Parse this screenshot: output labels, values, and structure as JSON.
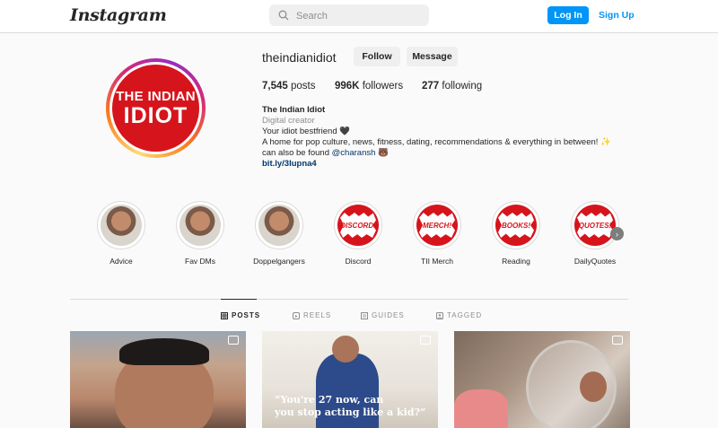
{
  "header": {
    "logo": "Instagram",
    "search_placeholder": "Search",
    "login_label": "Log In",
    "signup_label": "Sign Up"
  },
  "profile": {
    "username": "theindianidiot",
    "follow_label": "Follow",
    "message_label": "Message",
    "avatar_line1": "THE INDIAN",
    "avatar_line2": "IDIOT",
    "stats": {
      "posts_count": "7,545",
      "posts_label": "posts",
      "followers_count": "996K",
      "followers_label": "followers",
      "following_count": "277",
      "following_label": "following"
    },
    "bio": {
      "name": "The Indian Idiot",
      "category": "Digital creator",
      "line1": "Your idiot bestfriend 🖤",
      "line2": "A home for pop culture, news, fitness, dating, recommendations & everything in between! ✨",
      "line3_prefix": "can also be found ",
      "mention": "@charansh",
      "line3_suffix": " 🐻",
      "link": "bit.ly/3Iupna4"
    }
  },
  "highlights": [
    {
      "label": "Advice",
      "kind": "face"
    },
    {
      "label": "Fav DMs",
      "kind": "face"
    },
    {
      "label": "Doppelgangers",
      "kind": "face"
    },
    {
      "label": "Discord",
      "kind": "red",
      "sticker": "DISCORD!"
    },
    {
      "label": "TII Merch",
      "kind": "red",
      "sticker": "MERCH!"
    },
    {
      "label": "Reading",
      "kind": "red",
      "sticker": "BOOKS!"
    },
    {
      "label": "DailyQuotes",
      "kind": "red",
      "sticker": "QUOTES!"
    }
  ],
  "tabs": {
    "posts": "POSTS",
    "reels": "REELS",
    "guides": "GUIDES",
    "tagged": "TAGGED"
  },
  "posts": [
    {
      "caption": ""
    },
    {
      "caption_line1": "“You're 27 now, can",
      "caption_line2": "you stop acting like a kid?”"
    },
    {
      "caption": ""
    }
  ],
  "colors": {
    "accent": "#0095f6",
    "brand_red": "#d6141c",
    "link": "#00376b"
  }
}
